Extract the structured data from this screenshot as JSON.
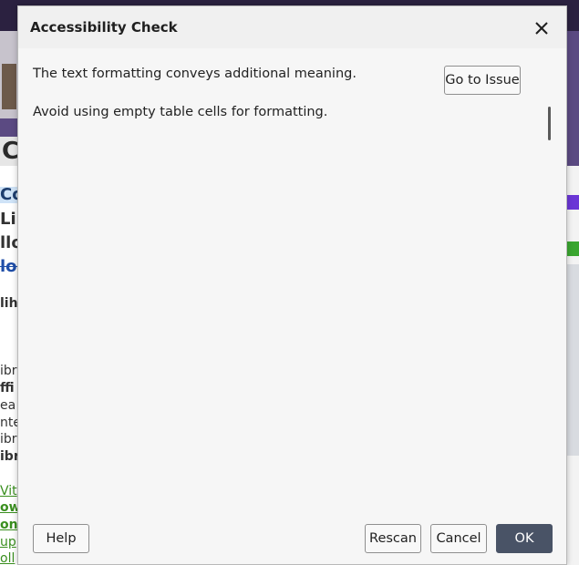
{
  "background": {
    "banner_text": "Co",
    "lines": [
      {
        "text": "Col",
        "style": "big hl"
      },
      {
        "text": "Lib",
        "style": "big"
      },
      {
        "text": "llo",
        "style": "big"
      },
      {
        "text": "loo",
        "style": "big strike"
      },
      {
        "text": "lih",
        "style": "bold"
      },
      {
        "text": "ibr",
        "style": ""
      },
      {
        "text": "ffi",
        "style": "bold"
      },
      {
        "text": "ea",
        "style": ""
      },
      {
        "text": "nte",
        "style": ""
      },
      {
        "text": "ibr",
        "style": ""
      },
      {
        "text": "ibr",
        "style": "bold"
      },
      {
        "text": "Vit",
        "style": "link"
      },
      {
        "text": "ow",
        "style": "link bold"
      },
      {
        "text": "onl",
        "style": "link bold"
      },
      {
        "text": "up",
        "style": "link"
      },
      {
        "text": "oll",
        "style": "link"
      }
    ]
  },
  "dialog": {
    "title": "Accessibility Check",
    "close_icon": "close-icon",
    "issues": [
      {
        "text": "The text formatting conveys additional meaning.",
        "button": "Go to Issue"
      },
      {
        "text": "Avoid using empty table cells for formatting."
      }
    ],
    "buttons": {
      "help": "Help",
      "rescan": "Rescan",
      "cancel": "Cancel",
      "ok": "OK"
    },
    "colors": {
      "ok_button": "#495366",
      "dialog_bg": "#f6f6f6"
    }
  }
}
